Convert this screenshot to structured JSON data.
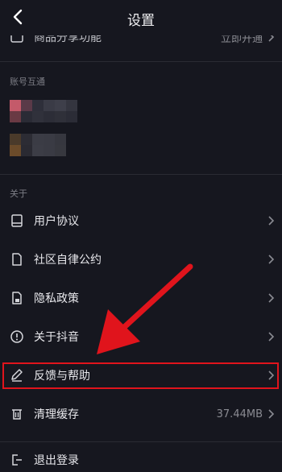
{
  "header": {
    "title": "设置"
  },
  "top_row": {
    "label": "商品分享功能",
    "value": "立即开通"
  },
  "section_accounts": "账号互通",
  "section_about": "关于",
  "about_items": [
    {
      "label": "用户协议",
      "icon": "book-icon"
    },
    {
      "label": "社区自律公约",
      "icon": "document-icon"
    },
    {
      "label": "隐私政策",
      "icon": "lock-document-icon"
    },
    {
      "label": "关于抖音",
      "icon": "info-icon"
    },
    {
      "label": "反馈与帮助",
      "icon": "pen-icon"
    },
    {
      "label": "清理缓存",
      "icon": "trash-icon",
      "value": "37.44MB"
    }
  ],
  "bottom_row": {
    "label": "退出登录"
  },
  "colors": {
    "background": "#16171f",
    "highlight": "#e0141c",
    "arrow": "#e0141c"
  }
}
